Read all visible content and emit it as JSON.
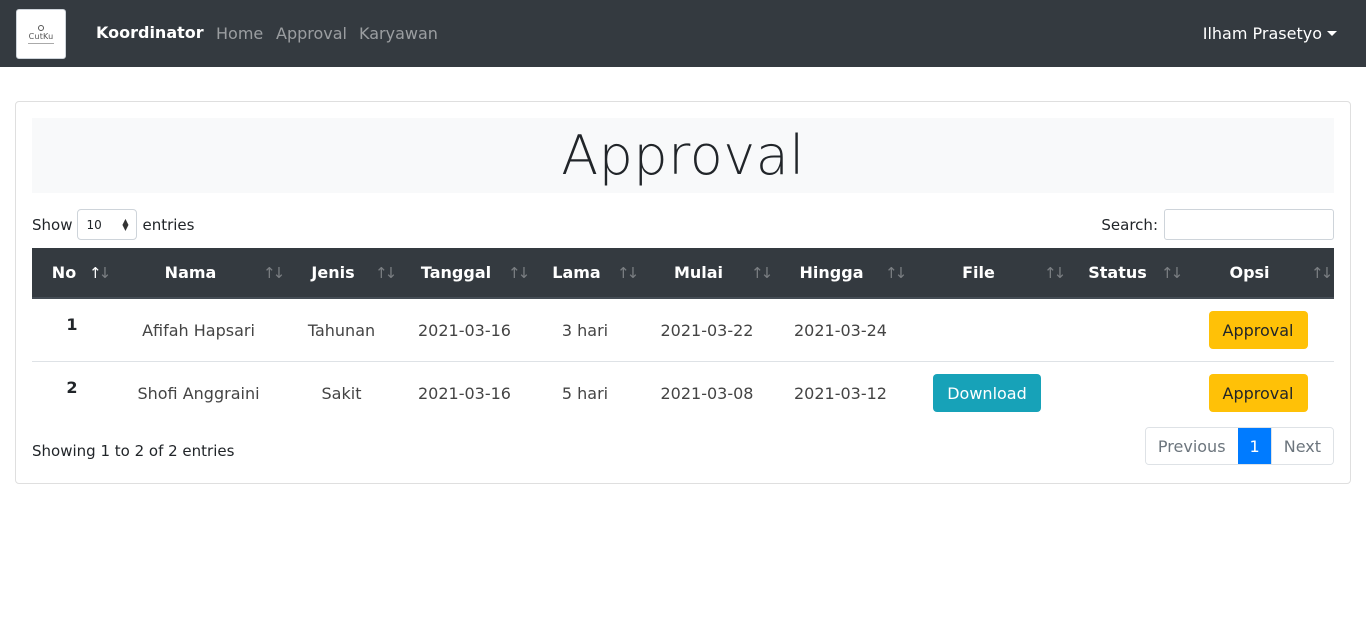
{
  "navbar": {
    "logo_text": "CutKu",
    "brand": "Koordinator",
    "links": [
      "Home",
      "Approval",
      "Karyawan"
    ],
    "user": "Ilham Prasetyo",
    "bg_color": "#343a40"
  },
  "page": {
    "title": "Approval"
  },
  "table_controls": {
    "show_label": "Show",
    "entries_value": "10",
    "entries_label": "entries",
    "search_label": "Search:",
    "search_value": ""
  },
  "table": {
    "columns": [
      "No",
      "Nama",
      "Jenis",
      "Tanggal",
      "Lama",
      "Mulai",
      "Hingga",
      "File",
      "Status",
      "Opsi"
    ],
    "sort_active_column": "No",
    "rows": [
      {
        "no": "1",
        "nama": "Afifah Hapsari",
        "jenis": "Tahunan",
        "tanggal": "2021-03-16",
        "lama": "3 hari",
        "mulai": "2021-03-22",
        "hingga": "2021-03-24",
        "file": "",
        "status": "",
        "opsi": "Approval"
      },
      {
        "no": "2",
        "nama": "Shofi Anggraini",
        "jenis": "Sakit",
        "tanggal": "2021-03-16",
        "lama": "5 hari",
        "mulai": "2021-03-08",
        "hingga": "2021-03-12",
        "file": "Download",
        "status": "",
        "opsi": "Approval"
      }
    ]
  },
  "footer": {
    "info": "Showing 1 to 2 of 2 entries",
    "previous": "Previous",
    "current_page": "1",
    "next": "Next"
  },
  "colors": {
    "accent": "#007bff",
    "info_button": "#17a2b8",
    "warning_button": "#ffc107"
  }
}
